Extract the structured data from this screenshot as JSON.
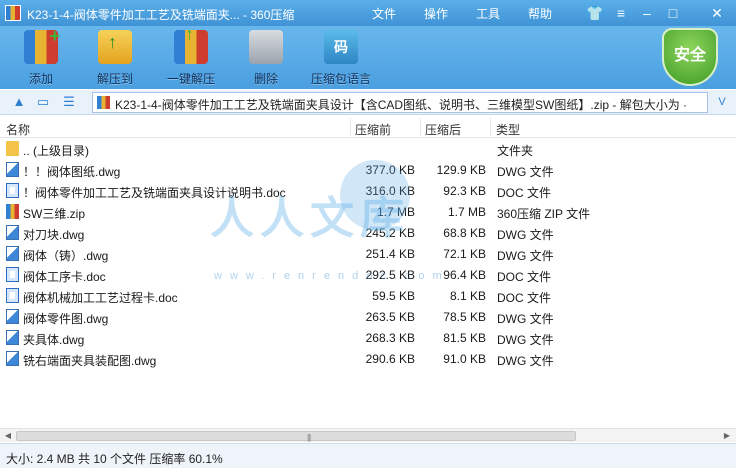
{
  "window": {
    "title": "K23-1-4-阀体零件加工工艺及铣端面夹... - 360压缩",
    "menu": [
      "文件",
      "操作",
      "工具",
      "帮助"
    ],
    "icons": [
      "shirt-icon",
      "menu-icon",
      "minimize-icon",
      "maximize-icon",
      "close-icon"
    ]
  },
  "toolbar": {
    "buttons": [
      {
        "label": "添加",
        "icon": "add-archive-icon"
      },
      {
        "label": "解压到",
        "icon": "extract-to-icon"
      },
      {
        "label": "一键解压",
        "icon": "one-click-extract-icon"
      },
      {
        "label": "删除",
        "icon": "delete-icon"
      },
      {
        "label": "压缩包语言",
        "icon": "language-icon",
        "glyph": "码"
      }
    ],
    "security_badge": "安全"
  },
  "addressbar": {
    "path": "K23-1-4-阀体零件加工工艺及铣端面夹具设计【含CAD图纸、说明书、三维模型SW图纸】.zip - 解包大小为 ·"
  },
  "columns": {
    "name": "名称",
    "size": "压缩前",
    "compressed": "压缩后",
    "type": "类型"
  },
  "files": [
    {
      "name": ".. (上级目录)",
      "size": "",
      "compressed": "",
      "type": "文件夹",
      "kind": "folder"
    },
    {
      "name": "！！阀体图纸.dwg",
      "size": "377.0 KB",
      "compressed": "129.9 KB",
      "type": "DWG 文件",
      "kind": "dwg"
    },
    {
      "name": "！阀体零件加工工艺及铣端面夹具设计说明书.doc",
      "size": "316.0 KB",
      "compressed": "92.3 KB",
      "type": "DOC 文件",
      "kind": "doc"
    },
    {
      "name": "SW三维.zip",
      "size": "1.7 MB",
      "compressed": "1.7 MB",
      "type": "360压缩 ZIP 文件",
      "kind": "zip"
    },
    {
      "name": "对刀块.dwg",
      "size": "245.2 KB",
      "compressed": "68.8 KB",
      "type": "DWG 文件",
      "kind": "dwg"
    },
    {
      "name": "阀体（铸）.dwg",
      "size": "251.4 KB",
      "compressed": "72.1 KB",
      "type": "DWG 文件",
      "kind": "dwg"
    },
    {
      "name": "阀体工序卡.doc",
      "size": "292.5 KB",
      "compressed": "96.4 KB",
      "type": "DOC 文件",
      "kind": "doc"
    },
    {
      "name": "阀体机械加工工艺过程卡.doc",
      "size": "59.5 KB",
      "compressed": "8.1 KB",
      "type": "DOC 文件",
      "kind": "doc"
    },
    {
      "name": "阀体零件图.dwg",
      "size": "263.5 KB",
      "compressed": "78.5 KB",
      "type": "DWG 文件",
      "kind": "dwg"
    },
    {
      "name": "夹具体.dwg",
      "size": "268.3 KB",
      "compressed": "81.5 KB",
      "type": "DWG 文件",
      "kind": "dwg"
    },
    {
      "name": "铣右端面夹具装配图.dwg",
      "size": "290.6 KB",
      "compressed": "91.0 KB",
      "type": "DWG 文件",
      "kind": "dwg"
    }
  ],
  "watermark": {
    "text": "人人文库",
    "url": "www.renrendoc.com"
  },
  "status": {
    "text": "大小: 2.4 MB 共 10 个文件 压缩率 60.1%"
  }
}
